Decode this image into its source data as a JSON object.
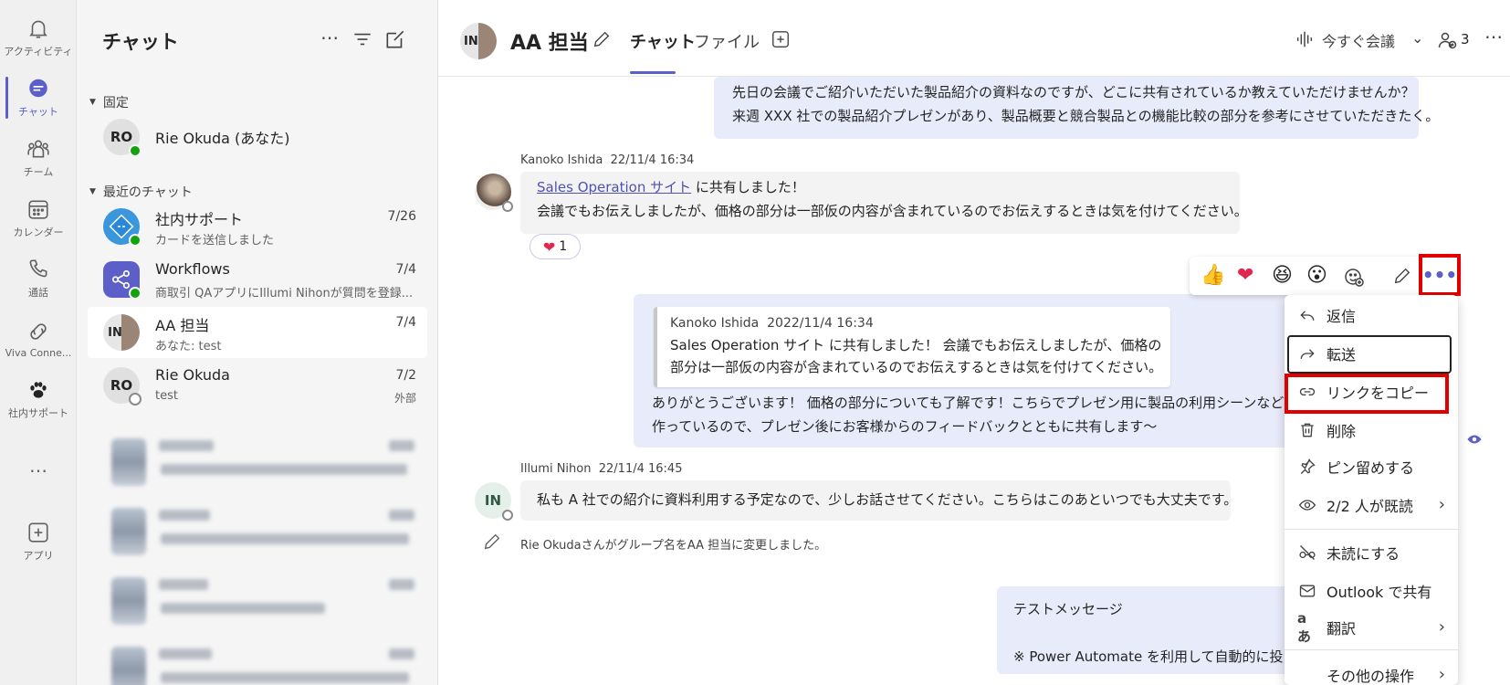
{
  "rail": {
    "items": [
      {
        "label": "アクティビティ",
        "icon": "bell-icon"
      },
      {
        "label": "チャット",
        "icon": "chat-icon",
        "active": true
      },
      {
        "label": "チーム",
        "icon": "teams-icon"
      },
      {
        "label": "カレンダー",
        "icon": "calendar-icon"
      },
      {
        "label": "通話",
        "icon": "phone-icon"
      },
      {
        "label": "Viva Conne...",
        "icon": "viva-icon"
      },
      {
        "label": "社内サポート",
        "icon": "paw-icon"
      },
      {
        "label": "…",
        "icon": "more-icon"
      },
      {
        "label": "アプリ",
        "icon": "add-app-icon"
      }
    ]
  },
  "list": {
    "title": "チャット",
    "pinned_label": "固定",
    "recent_label": "最近のチャット",
    "pinned": [
      {
        "initials": "RO",
        "name": "Rie Okuda (あなた)"
      }
    ],
    "recent": [
      {
        "name": "社内サポート",
        "preview": "カードを送信しました",
        "date": "7/26"
      },
      {
        "name": "Workflows",
        "preview": "商取引 QAアプリにIllumi Nihonが質問を登録...",
        "date": "7/4"
      },
      {
        "initials": "IN",
        "name": "AA 担当",
        "preview": "あなた: test",
        "date": "7/4"
      },
      {
        "initials": "RO",
        "name": "Rie Okuda",
        "preview": "test",
        "date": "7/2",
        "sub": "外部"
      }
    ]
  },
  "header": {
    "avatar_initials": "IN",
    "title": "AA 担当",
    "tabs": [
      "チャット",
      "ファイル"
    ],
    "meet_now": "今すぐ会議",
    "participants": "3"
  },
  "messages": {
    "m1": {
      "line1": "先日の会議でご紹介いただいた製品紹介の資料なのですが、どこに共有されているか教えていただけませんか？",
      "line2": "来週 XXX 社での製品紹介プレゼンがあり、製品概要と競合製品との機能比較の部分を参考にさせていただきたく。"
    },
    "m2": {
      "author": "Kanoko Ishida",
      "time": "22/11/4 16:34",
      "link_text": "Sales Operation サイト",
      "line1_rest": " に共有しました！",
      "line2": "会議でもお伝えしましたが、価格の部分は一部仮の内容が含まれているのでお伝えするときは気を付けてください。",
      "reaction_count": "1"
    },
    "m3": {
      "quote_author": "Kanoko Ishida",
      "quote_time": "2022/11/4 16:34",
      "quote_line1": "Sales Operation サイト に共有しました！ 会議でもお伝えしましたが、価格の",
      "quote_line2": "部分は一部仮の内容が含まれているのでお伝えするときは気を付けてください。",
      "line1": "ありがとうございます！ 価格の部分についても了解です！こちらでプレゼン用に製品の利用シーンなど画面",
      "line2": "作っているので、プレゼン後にお客様からのフィードバックとともに共有します～"
    },
    "m4": {
      "author": "Illumi Nihon",
      "time": "22/11/4 16:45",
      "avatar_initials": "IN",
      "text": "私も A 社での紹介に資料利用する予定なので、少しお話させてください。こちらはこのあといつでも大丈夫です。"
    },
    "event": "Rie Okudaさんがグループ名をAA 担当に変更しました。",
    "m5": {
      "line1": "テストメッセージ",
      "line2": "※ Power Automate を利用して自動的に投"
    }
  },
  "menu": {
    "items": [
      {
        "label": "返信",
        "icon": "reply-icon"
      },
      {
        "label": "転送",
        "icon": "forward-icon"
      },
      {
        "label": "リンクをコピー",
        "icon": "link-icon"
      },
      {
        "label": "削除",
        "icon": "trash-icon"
      },
      {
        "label": "ピン留めする",
        "icon": "pin-icon"
      },
      {
        "label": "2/2 人が既読",
        "icon": "eye-icon",
        "chevron": true
      },
      {
        "label": "未読にする",
        "icon": "unread-icon"
      },
      {
        "label": "Outlook で共有",
        "icon": "mail-icon"
      },
      {
        "label": "翻訳",
        "icon": "translate-icon",
        "chevron": true
      },
      {
        "label": "その他の操作",
        "icon": "more-actions-icon",
        "chevron": true
      }
    ]
  },
  "colors": {
    "accent": "#5b5fc7",
    "highlight": "#e00000",
    "mine_bubble": "#e8ebfa",
    "other_bubble": "#f3f3f3"
  }
}
